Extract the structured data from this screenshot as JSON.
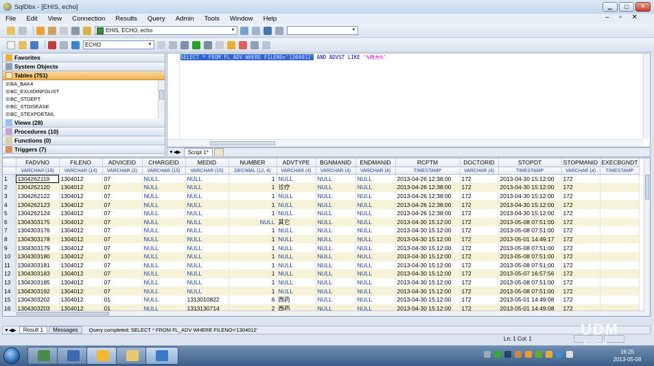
{
  "window": {
    "title": "SqlDbx - [EHIS, echo]"
  },
  "menu": [
    "File",
    "Edit",
    "View",
    "Connection",
    "Results",
    "Query",
    "Admin",
    "Tools",
    "Window",
    "Help"
  ],
  "toolbar": {
    "connection": "EHIS, ECHO, echo",
    "schema": "ECHO",
    "combo2": ""
  },
  "objects": {
    "favorites": "Favorites",
    "system_objects": "System Objects",
    "tables": "Tables (751)",
    "table_items": [
      "BA_BAK4",
      "BC_EXUIDINFOLIST",
      "BC_STDEPT",
      "BC_STDISEASE",
      "BC_STEXPDETAIL"
    ],
    "views": "Views (28)",
    "procedures": "Procedures (10)",
    "functions": "Functions (0)",
    "triggers": "Triggers (7)"
  },
  "editor": {
    "selected": "SELECT * FROM FL_ADV WHERE FILENO='1304012'",
    "rest_kw": " AND ADVST LIKE ",
    "rest_str": "'%特大%'"
  },
  "script_tab": "Script 1*",
  "grid": {
    "columns": [
      "FADVNO",
      "FILENO",
      "ADVICEID",
      "CHARGEID",
      "MEDID",
      "NUMBER",
      "ADVTYPE",
      "BGNMANID",
      "ENDMANID",
      "RCPTM",
      "DOCTORID",
      "STOPDT",
      "STOPMANID",
      "EXECBGNDT"
    ],
    "types": [
      "VARCHAR (14)",
      "VARCHAR (14)",
      "VARCHAR (2)",
      "VARCHAR (15)",
      "VARCHAR (15)",
      "DECIMAL (12, 4)",
      "VARCHAR (4)",
      "VARCHAR (4)",
      "VARCHAR (4)",
      "TIMESTAMP",
      "VARCHAR (4)",
      "TIMESTAMP",
      "VARCHAR (4)",
      "TIMESTAMP"
    ],
    "rows": [
      [
        "1",
        "1304262119",
        "1304012",
        "07",
        "NULL",
        "NULL",
        "1",
        "NULL",
        "NULL",
        "NULL",
        "2013-04-26 12:38:00",
        "172",
        "2013-04-30 15:12:00",
        "172",
        ""
      ],
      [
        "2",
        "1304262120",
        "1304012",
        "07",
        "NULL",
        "NULL",
        "1",
        "诊疗",
        "NULL",
        "NULL",
        "2013-04-26 12:38:00",
        "172",
        "2013-04-30 15:12:00",
        "172",
        ""
      ],
      [
        "3",
        "1304262122",
        "1304012",
        "07",
        "NULL",
        "NULL",
        "1",
        "NULL",
        "NULL",
        "NULL",
        "2013-04-26 12:38:00",
        "172",
        "2013-04-30 15:12:00",
        "172",
        ""
      ],
      [
        "4",
        "1304262123",
        "1304012",
        "07",
        "NULL",
        "NULL",
        "1",
        "NULL",
        "NULL",
        "NULL",
        "2013-04-26 12:38:00",
        "172",
        "2013-04-30 15:12:00",
        "172",
        ""
      ],
      [
        "5",
        "1304262124",
        "1304012",
        "07",
        "NULL",
        "NULL",
        "1",
        "NULL",
        "NULL",
        "NULL",
        "2013-04-26 12:38:00",
        "172",
        "2013-04-30 15:12:00",
        "172",
        ""
      ],
      [
        "6",
        "1304303175",
        "1304012",
        "07",
        "NULL",
        "NULL",
        "NULL",
        "其它",
        "NULL",
        "NULL",
        "2013-04-30 15:12:00",
        "172",
        "2013-05-08 07:51:00",
        "172",
        ""
      ],
      [
        "7",
        "1304303176",
        "1304012",
        "07",
        "NULL",
        "NULL",
        "1",
        "NULL",
        "NULL",
        "NULL",
        "2013-04-30 15:12:00",
        "172",
        "2013-05-08 07:51:00",
        "172",
        ""
      ],
      [
        "8",
        "1304303178",
        "1304012",
        "07",
        "NULL",
        "NULL",
        "1",
        "NULL",
        "NULL",
        "NULL",
        "2013-04-30 15:12:00",
        "172",
        "2013-05-01 14:49:17",
        "172",
        ""
      ],
      [
        "9",
        "1304303179",
        "1304012",
        "07",
        "NULL",
        "NULL",
        "1",
        "NULL",
        "NULL",
        "NULL",
        "2013-04-30 15:12:00",
        "172",
        "2013-05-08 07:51:00",
        "172",
        ""
      ],
      [
        "10",
        "1304303180",
        "1304012",
        "07",
        "NULL",
        "NULL",
        "1",
        "NULL",
        "NULL",
        "NULL",
        "2013-04-30 15:12:00",
        "172",
        "2013-05-08 07:51:00",
        "172",
        ""
      ],
      [
        "11",
        "1304303181",
        "1304012",
        "07",
        "NULL",
        "NULL",
        "1",
        "NULL",
        "NULL",
        "NULL",
        "2013-04-30 15:12:00",
        "172",
        "2013-05-08 07:51:00",
        "172",
        ""
      ],
      [
        "12",
        "1304303183",
        "1304012",
        "07",
        "NULL",
        "NULL",
        "1",
        "NULL",
        "NULL",
        "NULL",
        "2013-04-30 15:12:00",
        "172",
        "2013-05-07 16:57:56",
        "172",
        ""
      ],
      [
        "13",
        "1304303185",
        "1304012",
        "07",
        "NULL",
        "NULL",
        "1",
        "NULL",
        "NULL",
        "NULL",
        "2013-04-30 15:12:00",
        "172",
        "2013-05-08 07:51:00",
        "172",
        ""
      ],
      [
        "14",
        "1304303192",
        "1304012",
        "07",
        "NULL",
        "NULL",
        "1",
        "NULL",
        "NULL",
        "NULL",
        "2013-04-30 15:12:00",
        "172",
        "2013-05-08 07:51:00",
        "172",
        ""
      ],
      [
        "15",
        "1304303202",
        "1304012",
        "01",
        "NULL",
        "1313010822",
        "6",
        "西药",
        "NULL",
        "NULL",
        "2013-04-30 15:12:00",
        "172",
        "2013-05-01 14:49:08",
        "172",
        ""
      ],
      [
        "16",
        "1304303203",
        "1304012",
        "01",
        "NULL",
        "1313130714",
        "2",
        "西药",
        "NULL",
        "NULL",
        "2013-04-30 15:12:00",
        "172",
        "2013-05-01 14:49:08",
        "172",
        ""
      ]
    ]
  },
  "results": {
    "tab1": "Result 1",
    "tab2": "Messages",
    "message": "Query completed: SELECT * FROM FL_ADV WHERE FILENO='1304012'"
  },
  "status": {
    "position": "Ln: 1  Col: 1"
  },
  "taskbar": {
    "time": "16:25",
    "date": "2013-05-08"
  },
  "watermark": {
    "text": "UDM",
    "sub": "和力记易"
  },
  "colors": {
    "selection": "#3366cc",
    "null_text": "#1f3f9a",
    "stripe": "#f7f3d8",
    "active_section": "#f0b24f"
  }
}
